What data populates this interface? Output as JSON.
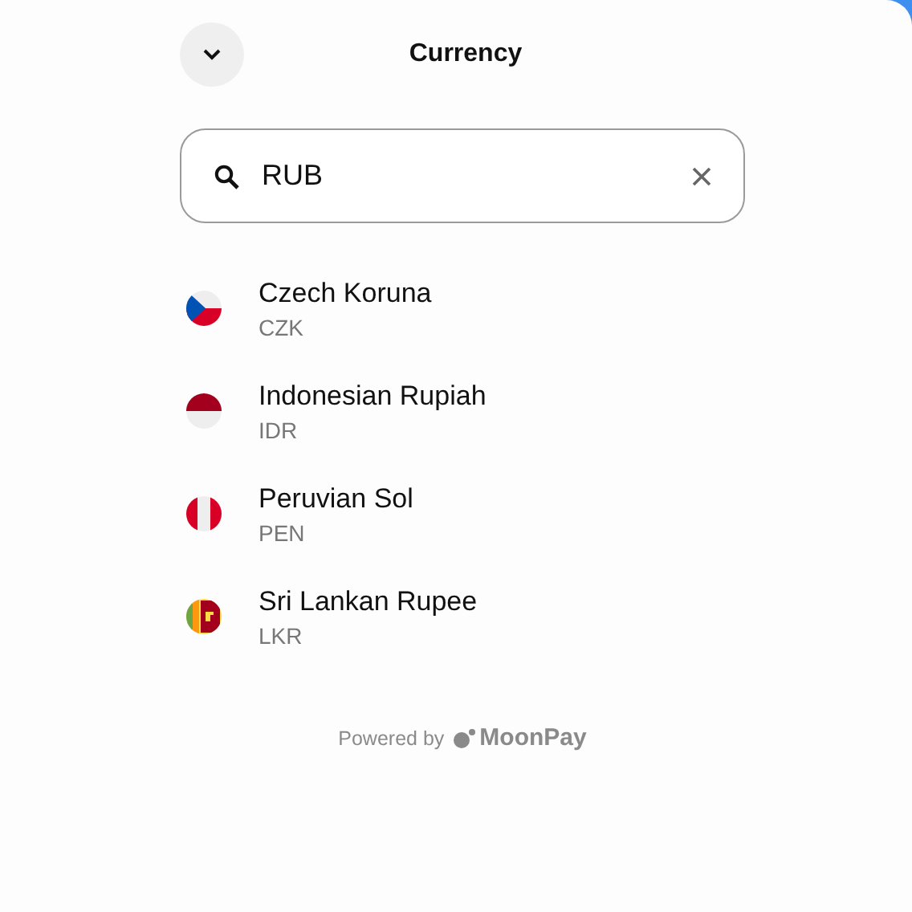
{
  "header": {
    "title": "Currency"
  },
  "search": {
    "value": "RUB"
  },
  "currencies": [
    {
      "name": "Czech Koruna",
      "code": "CZK",
      "kind": "cz"
    },
    {
      "name": "Indonesian Rupiah",
      "code": "IDR",
      "kind": "id"
    },
    {
      "name": "Peruvian Sol",
      "code": "PEN",
      "kind": "pe"
    },
    {
      "name": "Sri Lankan Rupee",
      "code": "LKR",
      "kind": "lk"
    }
  ],
  "footer": {
    "label": "Powered by",
    "brand": "MoonPay"
  }
}
